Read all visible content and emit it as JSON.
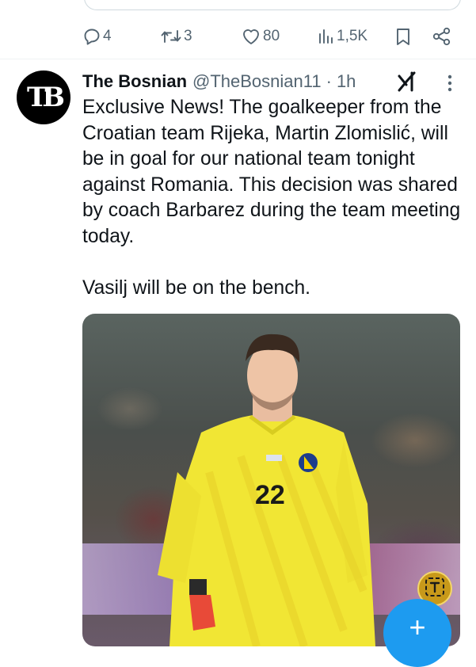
{
  "prev_tweet_actions": {
    "replies": "4",
    "retweets": "3",
    "likes": "80",
    "views": "1,5K"
  },
  "tweet": {
    "avatar_initials": "TB",
    "display_name": "The Bosnian",
    "handle": "@TheBosnian11",
    "separator": "·",
    "time": "1h",
    "paragraphs": [
      "Exclusive News! The goalkeeper from the Croatian team Rijeka, Martin Zlomislić, will be in goal for our national team tonight against Romania. This decision was shared by coach Barbarez during the team meeting today.",
      "Vasilj will be on the bench."
    ],
    "media": {
      "jersey_number": "22",
      "jersey_brand": "KELME"
    }
  },
  "icons": {
    "reply": "reply-icon",
    "retweet": "retweet-icon",
    "like": "heart-icon",
    "views": "views-icon",
    "bookmark": "bookmark-icon",
    "share": "share-icon",
    "grok": "grok-icon",
    "more": "more-vertical-icon",
    "translate": "translate-icon",
    "fab": "compose-plus-icon"
  },
  "colors": {
    "text_primary": "#0f1419",
    "text_secondary": "#536471",
    "accent": "#1d9bf0",
    "jersey": "#f1e634"
  }
}
